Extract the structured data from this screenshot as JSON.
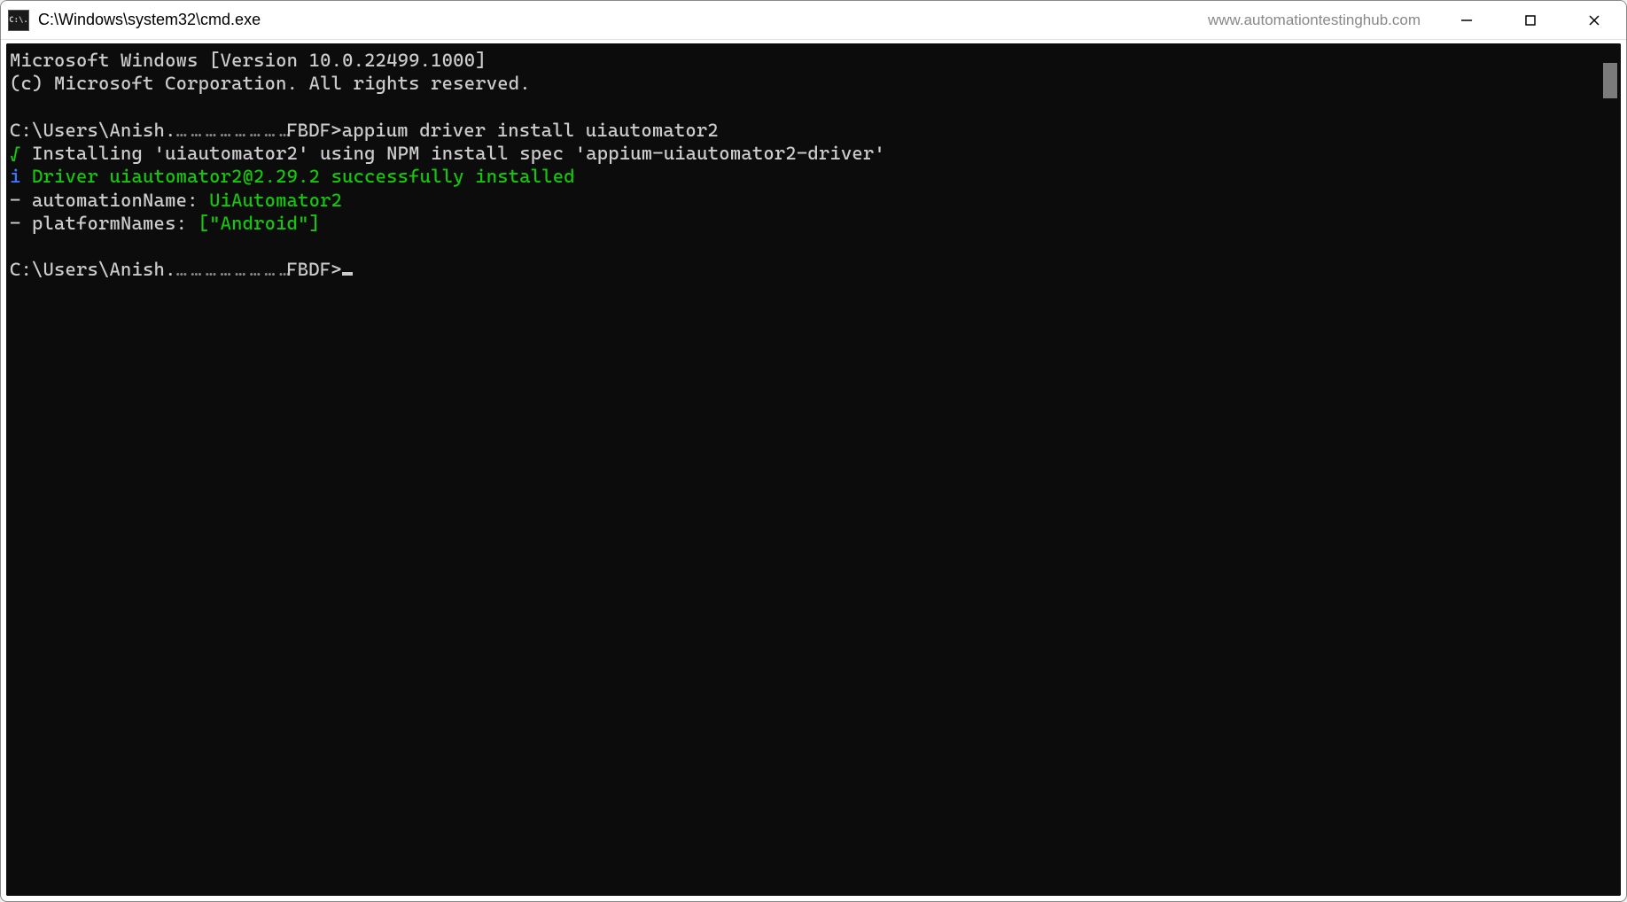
{
  "titlebar": {
    "icon_text": "C:\\.",
    "title": "C:\\Windows\\system32\\cmd.exe",
    "watermark": "www.automationtestinghub.com"
  },
  "terminal": {
    "header1": "Microsoft Windows [Version 10.0.22499.1000]",
    "header2": "(c) Microsoft Corporation. All rights reserved.",
    "prompt1_prefix": "C:\\Users\\Anish.",
    "prompt1_obscured": "… … … … … … … …",
    "prompt1_suffix": "FBDF>",
    "command1": "appium driver install uiautomator2",
    "line_install_check": "√",
    "line_install_text": " Installing 'uiautomator2' using NPM install spec 'appium-uiautomator2-driver'",
    "line_success_i": "i",
    "line_success_text": " Driver uiautomator2@2.29.2 successfully installed",
    "line_automation_prefix": "- automationName: ",
    "line_automation_value": "UiAutomator2",
    "line_platform_prefix": "- platformNames: ",
    "line_platform_value": "[\"Android\"]",
    "prompt2_prefix": "C:\\Users\\Anish.",
    "prompt2_obscured": "… … … … … … … …",
    "prompt2_suffix": "FBDF>"
  }
}
